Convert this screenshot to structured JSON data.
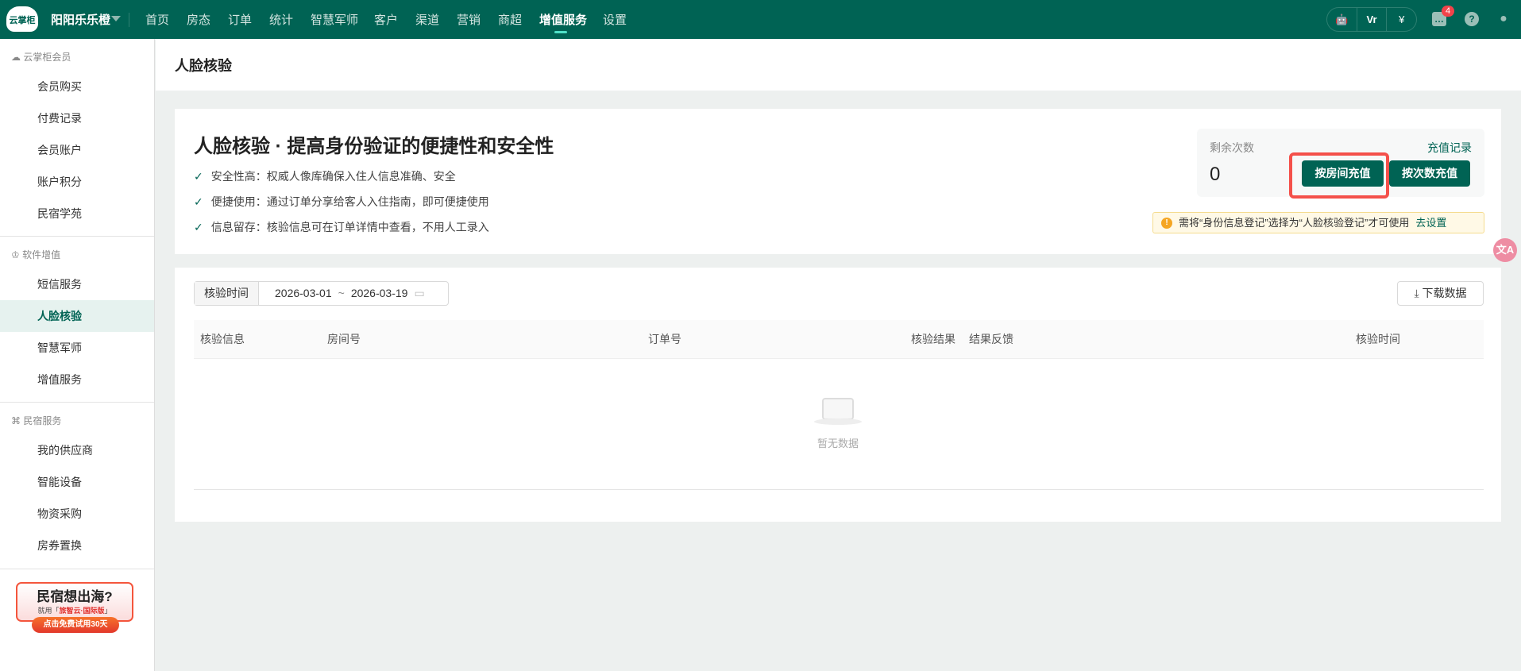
{
  "topbar": {
    "logo": "云掌柜",
    "shop": "阳阳乐乐橙",
    "nav": [
      "首页",
      "房态",
      "订单",
      "统计",
      "智慧军师",
      "客户",
      "渠道",
      "营销",
      "商超",
      "增值服务",
      "设置"
    ],
    "active": "增值服务",
    "badge": "4"
  },
  "sidebar": {
    "sections": [
      {
        "title": "云掌柜会员",
        "items": [
          "会员购买",
          "付费记录",
          "会员账户",
          "账户积分",
          "民宿学苑"
        ]
      },
      {
        "title": "软件增值",
        "items": [
          "短信服务",
          "人脸核验",
          "智慧军师",
          "增值服务"
        ]
      },
      {
        "title": "民宿服务",
        "items": [
          "我的供应商",
          "智能设备",
          "物资采购",
          "房券置换"
        ]
      }
    ],
    "active": "人脸核验",
    "banner": {
      "title": "民宿想出海?",
      "sub_prefix": "就用「",
      "sub_brand": "旅智云·国际版",
      "sub_suffix": "」",
      "cta": "点击免费试用30天"
    }
  },
  "page": {
    "title": "人脸核验",
    "intro": {
      "heading": "人脸核验 · 提高身份验证的便捷性和安全性",
      "features": [
        "安全性高：权威人像库确保入住人信息准确、安全",
        "便捷使用：通过订单分享给客人入住指南，即可便捷使用",
        "信息留存：核验信息可在订单详情中查看，不用人工录入"
      ]
    },
    "balance": {
      "label": "剩余次数",
      "value": "0",
      "history_link": "充值记录",
      "btn_room": "按房间充值",
      "btn_count": "按次数充值"
    },
    "warning": {
      "text": "需将“身份信息登记”选择为“人脸核验登记”才可使用",
      "link": "去设置"
    },
    "filter": {
      "label": "核验时间",
      "start": "2026-03-01",
      "sep": "~",
      "end": "2026-03-19"
    },
    "download": "下载数据",
    "table": {
      "columns": [
        "核验信息",
        "房间号",
        "订单号",
        "核验结果",
        "结果反馈",
        "核验时间"
      ],
      "empty": "暂无数据"
    }
  }
}
